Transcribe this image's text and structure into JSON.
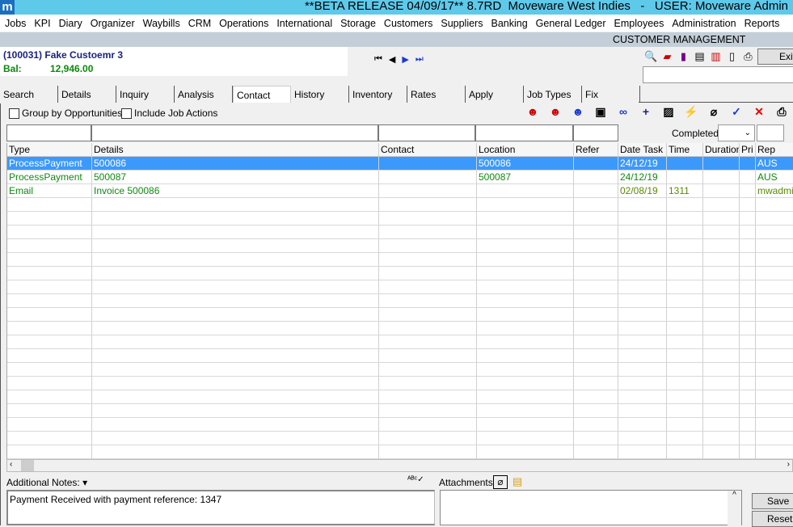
{
  "window": {
    "title": "**BETA RELEASE 04/09/17** 8.7RD  Moveware West Indies   -   USER: Moveware Admin",
    "logo": "m"
  },
  "menu": [
    "Jobs",
    "KPI",
    "Diary",
    "Organizer",
    "Waybills",
    "CRM",
    "Operations",
    "International",
    "Storage",
    "Customers",
    "Suppliers",
    "Banking",
    "General Ledger",
    "Employees",
    "Administration",
    "Reports"
  ],
  "header": {
    "title": "CUSTOMER MANAGEMENT"
  },
  "customer": {
    "name": "(100031) Fake Custoemr 3",
    "bal_label": "Bal:",
    "balance": "12,946.00"
  },
  "nav": {
    "first": "⏮",
    "prev": "◀",
    "next": "▶",
    "last": "⏭"
  },
  "exit_label": "Exit",
  "tabs": [
    "Search",
    "Details",
    "Inquiry",
    "Analysis",
    "Contact",
    "History",
    "Inventory",
    "Rates",
    "Apply",
    "Job Types",
    "Fix"
  ],
  "active_tab": "Contact",
  "options": {
    "group_by": "Group by Opportunities",
    "include_job_actions": "Include Job Actions"
  },
  "filter": {
    "completed_label": "Completed:",
    "completed_value": ""
  },
  "grid": {
    "columns": [
      "Type",
      "Details",
      "Contact",
      "Location",
      "Refer",
      "Date Task",
      "Time",
      "Duration",
      "Pri",
      "Rep"
    ],
    "rows": [
      [
        "ProcessPayment",
        "500086",
        "",
        "500086",
        "",
        "24/12/19",
        "",
        "",
        "",
        "AUS"
      ],
      [
        "ProcessPayment",
        "500087",
        "",
        "500087",
        "",
        "24/12/19",
        "",
        "",
        "",
        "AUS"
      ],
      [
        "Email",
        "Invoice 500086",
        "",
        "",
        "",
        "02/08/19",
        "1311",
        "",
        "",
        "mwadmin"
      ]
    ]
  },
  "notes": {
    "label": "Additional Notes:",
    "text": "Payment Received with payment reference: 1347"
  },
  "attachments": {
    "label": "Attachments"
  },
  "buttons": {
    "save": "Save",
    "reset": "Reset"
  },
  "colors": {
    "titlebar": "#5fc9ea",
    "selected_row": "#3b99fc",
    "row_text": "#0f8a0f"
  }
}
